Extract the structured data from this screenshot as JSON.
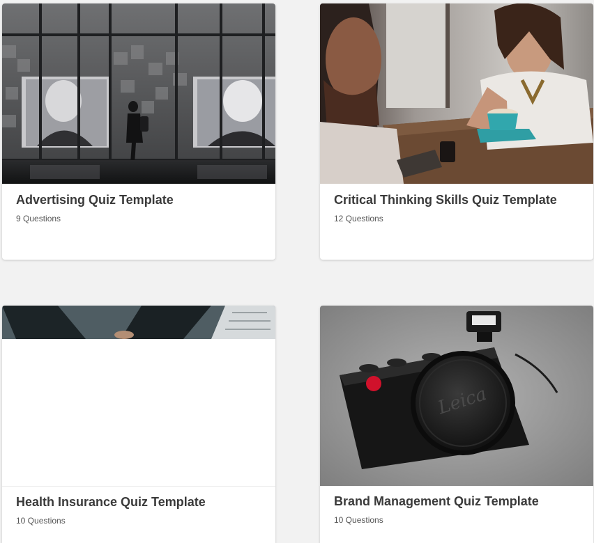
{
  "templates": [
    {
      "title": "Advertising Quiz Template",
      "count": "9 Questions",
      "image": "advertising-photo"
    },
    {
      "title": "Critical Thinking Skills Quiz Template",
      "count": "12 Questions",
      "image": "cafe-conversation-photo"
    },
    {
      "title": "Health Insurance Quiz Template",
      "count": "10 Questions",
      "image": "desk-hands-photo"
    },
    {
      "title": "Brand Management Quiz Template",
      "count": "10 Questions",
      "image": "leica-camera-photo",
      "image_text": "Leica"
    }
  ]
}
